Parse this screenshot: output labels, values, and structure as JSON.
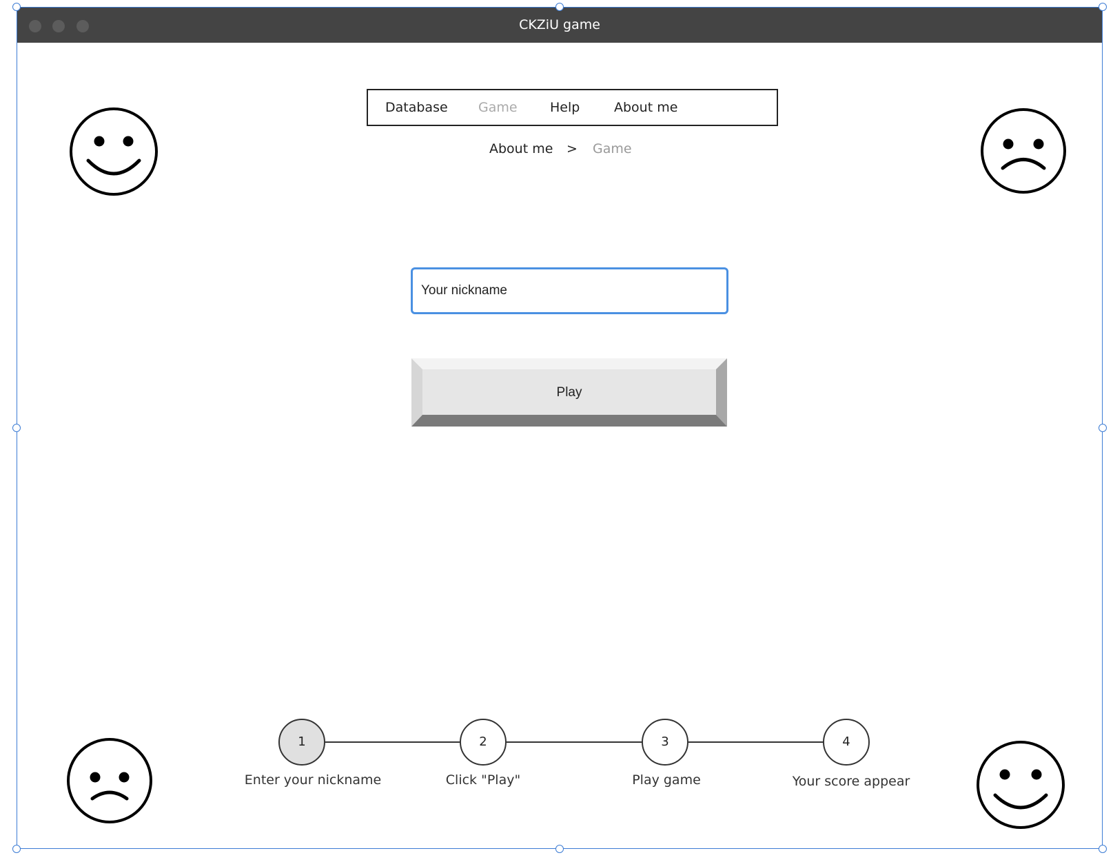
{
  "window": {
    "title": "CKZiU game"
  },
  "nav": {
    "items": [
      {
        "label": "Database",
        "active": false
      },
      {
        "label": "Game",
        "active": true
      },
      {
        "label": "Help",
        "active": false
      },
      {
        "label": "About me",
        "active": false
      }
    ]
  },
  "breadcrumb": {
    "parent": "About me",
    "separator": ">",
    "current": "Game"
  },
  "form": {
    "nickname_value": "Your nickname",
    "play_label": "Play"
  },
  "steps": [
    {
      "number": "1",
      "label": "Enter your nickname",
      "active": true
    },
    {
      "number": "2",
      "label": "Click \"Play\"",
      "active": false
    },
    {
      "number": "3",
      "label": "Play game",
      "active": false
    },
    {
      "number": "4",
      "label": "Your score appear",
      "active": false
    }
  ],
  "decorations": {
    "top_left": "smiley-happy-icon",
    "top_right": "smiley-sad-icon",
    "bottom_left": "smiley-sad-icon",
    "bottom_right": "smiley-happy-icon"
  },
  "colors": {
    "titlebar": "#444444",
    "selection": "#3b7bd4",
    "input_focus": "#4a90e2",
    "active_step": "#e0e0e0",
    "inactive_nav": "#aaaaaa"
  }
}
